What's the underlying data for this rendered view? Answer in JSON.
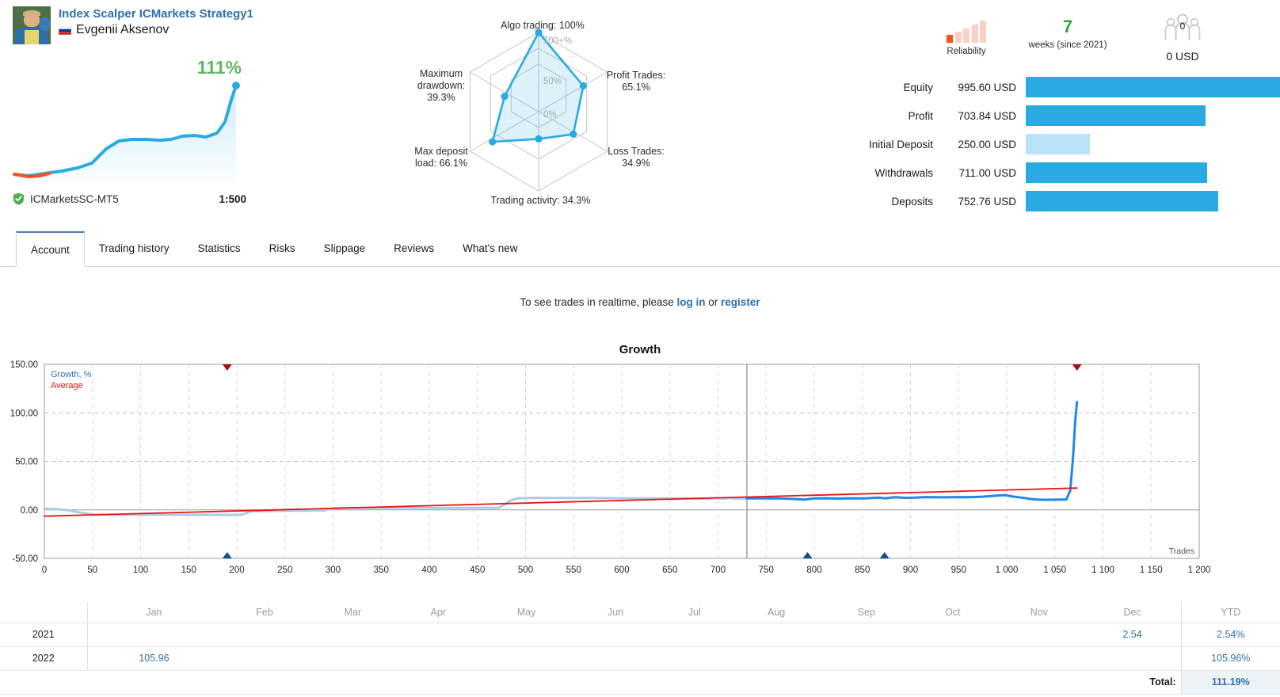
{
  "signal": {
    "title": "Index Scalper ICMarkets Strategy1",
    "author": "Evgenii Aksenov",
    "growth_percent": "111%",
    "broker": "ICMarketsSC-MT5",
    "leverage": "1:500",
    "avatar_icon": "user-photo",
    "flag_icon": "russia-flag-icon",
    "verified_icon": "green-shield-check-icon"
  },
  "radar": {
    "axes": [
      {
        "key": "algo_trading",
        "label": "Algo trading: 100%",
        "value": 100
      },
      {
        "key": "profit_trades",
        "label": "Profit Trades:\n65.1%",
        "value": 65.1
      },
      {
        "key": "loss_trades",
        "label": "Loss Trades:\n34.9%",
        "value": 34.9
      },
      {
        "key": "trading_activity",
        "label": "Trading activity: 34.3%",
        "value": 34.3
      },
      {
        "key": "max_deposit_load",
        "label": "Max deposit\nload: 66.1%",
        "value": 66.1
      },
      {
        "key": "max_drawdown",
        "label": "Maximum\ndrawdown:\n39.3%",
        "value": 39.3
      }
    ],
    "ring_labels": {
      "outer": "100+%",
      "middle": "50%",
      "center": "0%"
    },
    "label_top": "Algo trading: 100%",
    "label_right_1": "Profit Trades:",
    "label_right_2": "65.1%",
    "label_right_3": "Loss Trades:",
    "label_right_4": "34.9%",
    "label_bottom": "Trading activity: 34.3%",
    "label_left_1": "Max deposit",
    "label_left_2": "load: 66.1%",
    "label_left_3": "Maximum",
    "label_left_4": "drawdown:",
    "label_left_5": "39.3%"
  },
  "badges": {
    "reliability_label": "Reliability",
    "reliability_filled": 1,
    "reliability_total": 5,
    "weeks_value": "7",
    "weeks_label": "weeks (since 2021)",
    "subscribers_count": "0",
    "subscribers_value": "0 USD",
    "subscribers_icon": "people-group-icon"
  },
  "stats": [
    {
      "label": "Equity",
      "value": "995.60 USD",
      "bar_percent": 100.0,
      "pale": false
    },
    {
      "label": "Profit",
      "value": "703.84 USD",
      "bar_percent": 70.7,
      "pale": false
    },
    {
      "label": "Initial Deposit",
      "value": "250.00 USD",
      "bar_percent": 25.1,
      "pale": true
    },
    {
      "label": "Withdrawals",
      "value": "711.00 USD",
      "bar_percent": 71.4,
      "pale": false
    },
    {
      "label": "Deposits",
      "value": "752.76 USD",
      "bar_percent": 75.6,
      "pale": false
    }
  ],
  "tabs": [
    {
      "label": "Account",
      "active": true
    },
    {
      "label": "Trading history",
      "active": false
    },
    {
      "label": "Statistics",
      "active": false
    },
    {
      "label": "Risks",
      "active": false
    },
    {
      "label": "Slippage",
      "active": false
    },
    {
      "label": "Reviews",
      "active": false
    },
    {
      "label": "What's new",
      "active": false
    }
  ],
  "notice": {
    "prefix": "To see trades in realtime, please ",
    "login": "log in",
    "middle": " or ",
    "register": "register"
  },
  "chart_data": {
    "type": "line",
    "title": "Growth",
    "xlabel": "Trades",
    "ylabel": "",
    "xlim": [
      0,
      1200
    ],
    "ylim": [
      -50,
      150
    ],
    "ytick_labels": [
      "150.00",
      "100.00",
      "50.00",
      "0.00",
      "-50.00"
    ],
    "yticks": [
      150,
      100,
      50,
      0,
      -50
    ],
    "xticks": [
      0,
      50,
      100,
      150,
      200,
      250,
      300,
      350,
      400,
      450,
      500,
      550,
      600,
      650,
      700,
      750,
      800,
      850,
      900,
      950,
      1000,
      1050,
      1100,
      1150,
      1200
    ],
    "xtick_labels": [
      "0",
      "50",
      "100",
      "150",
      "200",
      "250",
      "300",
      "350",
      "400",
      "450",
      "500",
      "550",
      "600",
      "650",
      "700",
      "750",
      "800",
      "850",
      "900",
      "950",
      "1 000",
      "1 050",
      "1 100",
      "1 150",
      "1 200"
    ],
    "grid": true,
    "legend_position": "top-left",
    "legend": [
      {
        "name": "Growth, %",
        "color": "#2f6fad"
      },
      {
        "name": "Average",
        "color": "#ee1111"
      }
    ],
    "year_divider_x": 730,
    "series": [
      {
        "name": "Growth, % (2021)",
        "color": "#a9cbe8",
        "points": [
          [
            0,
            1.0
          ],
          [
            12,
            0.8
          ],
          [
            24,
            -0.2
          ],
          [
            38,
            -3.0
          ],
          [
            52,
            -4.8
          ],
          [
            70,
            -5.0
          ],
          [
            100,
            -5.0
          ],
          [
            140,
            -5.0
          ],
          [
            170,
            -5.1
          ],
          [
            190,
            -5.2
          ],
          [
            205,
            -5.0
          ],
          [
            215,
            -1.5
          ],
          [
            235,
            -1.0
          ],
          [
            255,
            -0.9
          ],
          [
            275,
            -0.7
          ],
          [
            290,
            -0.6
          ],
          [
            300,
            1.5
          ],
          [
            310,
            2.0
          ],
          [
            330,
            2.0
          ],
          [
            360,
            2.0
          ],
          [
            400,
            2.0
          ],
          [
            440,
            2.0
          ],
          [
            465,
            2.0
          ],
          [
            472,
            2.2
          ],
          [
            478,
            5.5
          ],
          [
            484,
            9.5
          ],
          [
            492,
            12.0
          ],
          [
            500,
            12.3
          ],
          [
            512,
            12.4
          ],
          [
            520,
            12.3
          ],
          [
            545,
            12.2
          ],
          [
            570,
            12.2
          ],
          [
            600,
            12.0
          ],
          [
            630,
            11.9
          ],
          [
            660,
            11.8
          ],
          [
            690,
            11.6
          ],
          [
            700,
            12.2
          ],
          [
            706,
            11.4
          ],
          [
            712,
            12.3
          ],
          [
            718,
            11.6
          ],
          [
            725,
            12.0
          ],
          [
            730,
            11.9
          ]
        ]
      },
      {
        "name": "Growth, % (2022)",
        "color": "#1e88e5",
        "points": [
          [
            730,
            11.9
          ],
          [
            745,
            11.8
          ],
          [
            760,
            12.0
          ],
          [
            775,
            11.5
          ],
          [
            790,
            10.6
          ],
          [
            800,
            11.8
          ],
          [
            812,
            12.0
          ],
          [
            826,
            11.6
          ],
          [
            840,
            12.0
          ],
          [
            852,
            11.9
          ],
          [
            866,
            12.6
          ],
          [
            874,
            12.0
          ],
          [
            884,
            13.0
          ],
          [
            896,
            12.4
          ],
          [
            905,
            12.6
          ],
          [
            915,
            13.2
          ],
          [
            925,
            13.0
          ],
          [
            936,
            12.9
          ],
          [
            948,
            13.2
          ],
          [
            960,
            13.1
          ],
          [
            975,
            13.6
          ],
          [
            988,
            14.6
          ],
          [
            998,
            15.2
          ],
          [
            1005,
            14.0
          ],
          [
            1012,
            13.0
          ],
          [
            1018,
            12.3
          ],
          [
            1024,
            11.3
          ],
          [
            1032,
            10.6
          ],
          [
            1040,
            10.4
          ],
          [
            1048,
            10.5
          ],
          [
            1056,
            10.6
          ],
          [
            1062,
            10.7
          ],
          [
            1066,
            20.0
          ],
          [
            1069,
            55.0
          ],
          [
            1071,
            90.0
          ],
          [
            1073,
            111.19
          ]
        ]
      },
      {
        "name": "Average",
        "color": "#ee1111",
        "points": [
          [
            0,
            -6.5
          ],
          [
            1073,
            22.5
          ]
        ]
      }
    ],
    "top_markers": [
      190,
      1073
    ],
    "bottom_markers": [
      190,
      793,
      873
    ],
    "top_marker_color": "#a01010",
    "bottom_marker_color": "#10508f"
  },
  "month_table": {
    "months": [
      "Jan",
      "Feb",
      "Mar",
      "Apr",
      "May",
      "Jun",
      "Jul",
      "Aug",
      "Sep",
      "Oct",
      "Nov",
      "Dec"
    ],
    "ytd_header": "YTD",
    "rows": [
      {
        "year": "2021",
        "values": [
          "",
          "",
          "",
          "",
          "",
          "",
          "",
          "",
          "",
          "",
          "",
          "2.54"
        ],
        "ytd": "2.54%"
      },
      {
        "year": "2022",
        "values": [
          "105.96",
          "",
          "",
          "",
          "",
          "",
          "",
          "",
          "",
          "",
          "",
          ""
        ],
        "ytd": "105.96%"
      }
    ],
    "total_label": "Total:",
    "total_value": "111.19%"
  }
}
